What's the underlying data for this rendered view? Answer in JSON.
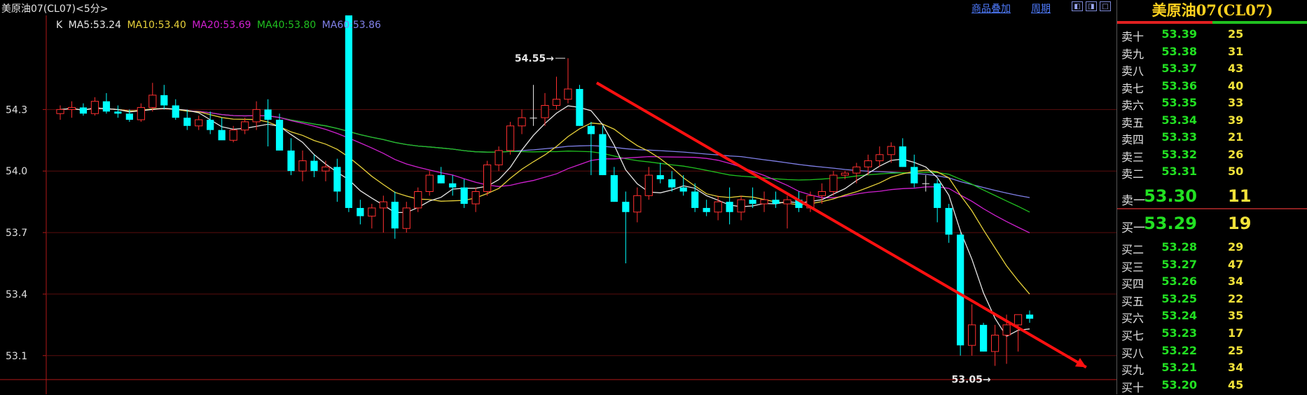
{
  "window": {
    "title": "美原油07(CL07)<5分>"
  },
  "toolbar": {
    "overlay_label": "商品叠加",
    "period_label": "周期"
  },
  "legend": {
    "k_label": "K",
    "ma": [
      {
        "label": "MA5:53.24",
        "color": "#e6e6e6"
      },
      {
        "label": "MA10:53.40",
        "color": "#e8d23a"
      },
      {
        "label": "MA20:53.69",
        "color": "#d020d0"
      },
      {
        "label": "MA40:53.80",
        "color": "#20c020"
      },
      {
        "label": "MA60:53.86",
        "color": "#8080e8"
      }
    ]
  },
  "chart_data": {
    "type": "candlestick",
    "y_ticks": [
      "54.3",
      "54.0",
      "53.7",
      "53.4",
      "53.1"
    ],
    "y_tick_values": [
      54.3,
      54.0,
      53.7,
      53.4,
      53.1
    ],
    "ylim": [
      52.99,
      54.67
    ],
    "annotations": {
      "high_label": "54.55",
      "low_label": "53.05",
      "high": 54.55,
      "low": 53.05
    },
    "colors": {
      "up": "#ff3030",
      "down": "#00ffff",
      "neutral": "#e6e6e6",
      "axis": "#b01818",
      "arrow": "#ff1010"
    },
    "trend_arrow": {
      "from": [
        54.43,
        46
      ],
      "to": [
        53.05,
        90
      ]
    },
    "candles": [
      [
        54.28,
        54.32,
        54.25,
        54.3
      ],
      [
        54.3,
        54.34,
        54.26,
        54.31
      ],
      [
        54.31,
        54.33,
        54.27,
        54.28
      ],
      [
        54.28,
        54.36,
        54.27,
        54.34
      ],
      [
        54.34,
        54.38,
        54.28,
        54.29
      ],
      [
        54.29,
        54.32,
        54.26,
        54.28
      ],
      [
        54.28,
        54.3,
        54.24,
        54.25
      ],
      [
        54.25,
        54.33,
        54.24,
        54.31
      ],
      [
        54.31,
        54.43,
        54.29,
        54.37
      ],
      [
        54.37,
        54.42,
        54.3,
        54.32
      ],
      [
        54.32,
        54.35,
        54.25,
        54.26
      ],
      [
        54.26,
        54.3,
        54.2,
        54.22
      ],
      [
        54.22,
        54.27,
        54.2,
        54.25
      ],
      [
        54.25,
        54.29,
        54.18,
        54.2
      ],
      [
        54.2,
        54.26,
        54.16,
        54.15
      ],
      [
        54.15,
        54.22,
        54.14,
        54.2
      ],
      [
        54.2,
        54.26,
        54.18,
        54.24
      ],
      [
        54.24,
        54.34,
        54.2,
        54.3
      ],
      [
        54.3,
        54.35,
        54.12,
        54.25
      ],
      [
        54.25,
        54.28,
        54.1,
        54.1
      ],
      [
        54.1,
        54.16,
        53.98,
        54.0
      ],
      [
        54.0,
        54.1,
        53.95,
        54.05
      ],
      [
        54.05,
        54.08,
        53.97,
        54.0
      ],
      [
        54.0,
        54.05,
        53.95,
        54.02
      ],
      [
        54.02,
        54.06,
        53.85,
        53.9
      ],
      [
        54.9,
        53.96,
        53.8,
        53.82
      ],
      [
        53.82,
        53.86,
        53.74,
        53.78
      ],
      [
        53.78,
        53.84,
        53.72,
        53.82
      ],
      [
        53.82,
        53.88,
        53.7,
        53.85
      ],
      [
        53.85,
        53.9,
        53.67,
        53.72
      ],
      [
        53.72,
        53.85,
        53.7,
        53.82
      ],
      [
        53.82,
        53.92,
        53.8,
        53.9
      ],
      [
        53.9,
        54.0,
        53.88,
        53.98
      ],
      [
        53.98,
        54.02,
        53.94,
        53.94
      ],
      [
        53.94,
        53.98,
        53.88,
        53.92
      ],
      [
        53.92,
        53.96,
        53.82,
        53.84
      ],
      [
        53.84,
        53.92,
        53.8,
        53.9
      ],
      [
        53.9,
        54.05,
        53.88,
        54.03
      ],
      [
        54.03,
        54.12,
        54.0,
        54.1
      ],
      [
        54.1,
        54.24,
        54.08,
        54.22
      ],
      [
        54.22,
        54.3,
        54.18,
        54.26
      ],
      [
        54.26,
        54.42,
        54.22,
        54.26
      ],
      [
        54.26,
        54.38,
        54.22,
        54.32
      ],
      [
        54.32,
        54.46,
        54.3,
        54.35
      ],
      [
        54.35,
        54.55,
        54.33,
        54.4
      ],
      [
        54.4,
        54.42,
        54.22,
        54.22
      ],
      [
        54.22,
        54.24,
        53.98,
        54.18
      ],
      [
        54.18,
        54.22,
        53.98,
        53.98
      ],
      [
        53.98,
        54.02,
        53.85,
        53.85
      ],
      [
        53.85,
        53.9,
        53.55,
        53.8
      ],
      [
        53.8,
        53.92,
        53.75,
        53.88
      ],
      [
        53.88,
        54.02,
        53.86,
        53.98
      ],
      [
        53.98,
        54.04,
        53.94,
        53.96
      ],
      [
        53.96,
        54.0,
        53.9,
        53.92
      ],
      [
        53.92,
        53.98,
        53.88,
        53.9
      ],
      [
        53.9,
        53.94,
        53.8,
        53.82
      ],
      [
        53.82,
        53.86,
        53.78,
        53.8
      ],
      [
        53.8,
        53.88,
        53.76,
        53.85
      ],
      [
        53.85,
        53.92,
        53.74,
        53.8
      ],
      [
        53.8,
        53.88,
        53.76,
        53.86
      ],
      [
        53.86,
        53.92,
        53.82,
        53.84
      ],
      [
        53.84,
        53.9,
        53.8,
        53.86
      ],
      [
        53.86,
        53.9,
        53.82,
        53.84
      ],
      [
        53.84,
        53.88,
        53.72,
        53.86
      ],
      [
        53.86,
        53.9,
        53.8,
        53.82
      ],
      [
        53.82,
        53.9,
        53.8,
        53.88
      ],
      [
        53.88,
        53.94,
        53.84,
        53.9
      ],
      [
        53.9,
        54.0,
        53.88,
        53.98
      ],
      [
        53.98,
        54.0,
        53.96,
        53.99
      ],
      [
        53.99,
        54.04,
        53.94,
        54.02
      ],
      [
        54.02,
        54.08,
        53.98,
        54.05
      ],
      [
        54.05,
        54.12,
        54.02,
        54.08
      ],
      [
        54.08,
        54.14,
        54.04,
        54.12
      ],
      [
        54.12,
        54.16,
        54.02,
        54.02
      ],
      [
        54.02,
        54.08,
        53.92,
        53.94
      ],
      [
        53.94,
        53.98,
        53.9,
        53.94
      ],
      [
        53.94,
        53.96,
        53.75,
        53.82
      ],
      [
        53.82,
        53.84,
        53.65,
        53.69
      ],
      [
        53.69,
        53.7,
        53.1,
        53.15
      ],
      [
        53.15,
        53.35,
        53.1,
        53.25
      ],
      [
        53.25,
        53.26,
        53.12,
        53.12
      ],
      [
        53.12,
        53.25,
        53.05,
        53.2
      ],
      [
        53.2,
        53.3,
        53.06,
        53.25
      ],
      [
        53.25,
        53.28,
        53.12,
        53.3
      ],
      [
        53.3,
        53.32,
        53.26,
        53.28
      ]
    ]
  },
  "quotes": {
    "title": "美原油07(CL07)",
    "sell": [
      {
        "label": "卖十",
        "price": "53.39",
        "vol": "25"
      },
      {
        "label": "卖九",
        "price": "53.38",
        "vol": "31"
      },
      {
        "label": "卖八",
        "price": "53.37",
        "vol": "43"
      },
      {
        "label": "卖七",
        "price": "53.36",
        "vol": "40"
      },
      {
        "label": "卖六",
        "price": "53.35",
        "vol": "33"
      },
      {
        "label": "卖五",
        "price": "53.34",
        "vol": "39"
      },
      {
        "label": "卖四",
        "price": "53.33",
        "vol": "21"
      },
      {
        "label": "卖三",
        "price": "53.32",
        "vol": "26"
      },
      {
        "label": "卖二",
        "price": "53.31",
        "vol": "50"
      }
    ],
    "sell1": {
      "label": "卖一",
      "price": "53.30",
      "vol": "11"
    },
    "buy1": {
      "label": "买一",
      "price": "53.29",
      "vol": "19"
    },
    "buy": [
      {
        "label": "买二",
        "price": "53.28",
        "vol": "29"
      },
      {
        "label": "买三",
        "price": "53.27",
        "vol": "47"
      },
      {
        "label": "买四",
        "price": "53.26",
        "vol": "34"
      },
      {
        "label": "买五",
        "price": "53.25",
        "vol": "22"
      },
      {
        "label": "买六",
        "price": "53.24",
        "vol": "35"
      },
      {
        "label": "买七",
        "price": "53.23",
        "vol": "17"
      },
      {
        "label": "买八",
        "price": "53.22",
        "vol": "25"
      },
      {
        "label": "买九",
        "price": "53.21",
        "vol": "34"
      },
      {
        "label": "买十",
        "price": "53.20",
        "vol": "45"
      }
    ]
  }
}
